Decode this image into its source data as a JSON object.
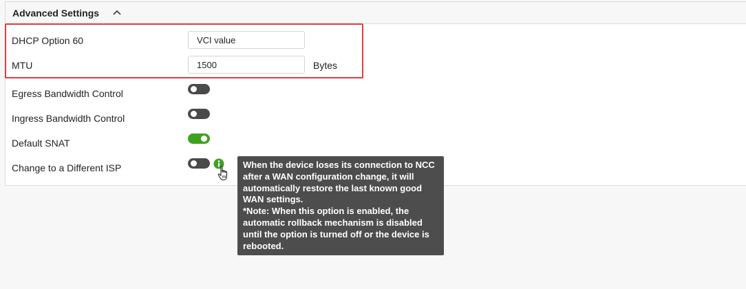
{
  "section": {
    "title": "Advanced Settings",
    "collapse_icon": "chevron-up-icon"
  },
  "fields": {
    "dhcp_option_60": {
      "label": "DHCP Option 60",
      "value": "VCI value"
    },
    "mtu": {
      "label": "MTU",
      "value": "1500",
      "unit": "Bytes"
    }
  },
  "toggles": {
    "egress": {
      "label": "Egress Bandwidth Control",
      "on": false
    },
    "ingress": {
      "label": "Ingress Bandwidth Control",
      "on": false
    },
    "default_snat": {
      "label": "Default SNAT",
      "on": true
    },
    "change_isp": {
      "label": "Change to a Different ISP",
      "on": false,
      "info_icon": "info-icon"
    }
  },
  "tooltip": {
    "text": "When the device loses its connection to NCC after a WAN configuration change, it will automatically restore the last known good WAN settings.",
    "note": "*Note: When this option is enabled, the automatic rollback mechanism is disabled until the option is turned off or the device is rebooted."
  },
  "colors": {
    "toggle_on": "#3fa21f",
    "toggle_off": "#4a4a4a",
    "highlight": "#e23c3c",
    "tooltip_bg": "#4d4d4d",
    "info_icon": "#3fa21f"
  }
}
